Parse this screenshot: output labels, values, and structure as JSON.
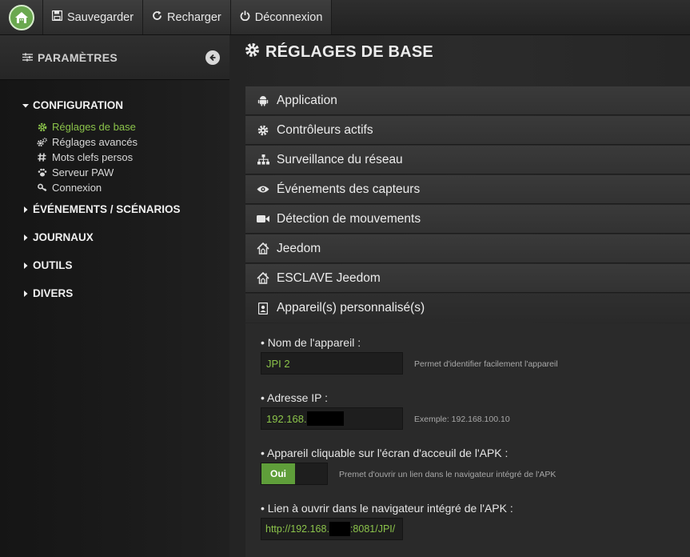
{
  "topbar": {
    "home_icon": "house-icon",
    "buttons": [
      {
        "icon": "floppy-disk-icon",
        "label": "Sauvegarder"
      },
      {
        "icon": "refresh-icon",
        "label": "Recharger"
      },
      {
        "icon": "power-icon",
        "label": "Déconnexion"
      }
    ]
  },
  "sidebar": {
    "title": "PARAMÈTRES",
    "configuration": {
      "label": "CONFIGURATION",
      "items": [
        {
          "label": "Réglages de base",
          "icon": "gear-icon",
          "active": true
        },
        {
          "label": "Réglages avancés",
          "icon": "gears-icon"
        },
        {
          "label": "Mots clefs persos",
          "icon": "hashtag-icon"
        },
        {
          "label": "Serveur PAW",
          "icon": "paw-icon"
        },
        {
          "label": "Connexion",
          "icon": "key-icon"
        }
      ]
    },
    "sections": [
      {
        "label": "ÉVÉNEMENTS / SCÉNARIOS"
      },
      {
        "label": "JOURNAUX"
      },
      {
        "label": "OUTILS"
      },
      {
        "label": "DIVERS"
      }
    ]
  },
  "main": {
    "title": "RÉGLAGES DE BASE",
    "panels": [
      {
        "label": "Application",
        "icon": "android-icon"
      },
      {
        "label": "Contrôleurs actifs",
        "icon": "gear-icon"
      },
      {
        "label": "Surveillance du réseau",
        "icon": "sitemap-icon"
      },
      {
        "label": "Événements des capteurs",
        "icon": "eye-icon"
      },
      {
        "label": "Détection de mouvements",
        "icon": "video-camera-icon"
      },
      {
        "label": "Jeedom",
        "icon": "jeedom-icon"
      },
      {
        "label": "ESCLAVE Jeedom",
        "icon": "jeedom-icon"
      },
      {
        "label": "Appareil(s) personnalisé(s)",
        "icon": "portrait-icon"
      }
    ],
    "device_form": {
      "name_label": "• Nom de l'appareil :",
      "name_value": "JPI 2",
      "name_help": "Permet d'identifier facilement l'appareil",
      "ip_label": "• Adresse IP :",
      "ip_value_prefix": "192.168.",
      "ip_help": "Exemple: 192.168.100.10",
      "clickable_label": "• Appareil cliquable sur l'écran d'acceuil de l'APK :",
      "clickable_value": "Oui",
      "clickable_help": "Premet d'ouvrir un lien dans le navigateur intégré de l'APK",
      "link_label": "• Lien à ouvrir dans le navigateur intégré de l'APK :",
      "link_value_prefix": "http://192.168.",
      "link_value_suffix": ":8081/JPI/"
    }
  },
  "colors": {
    "accent_green": "#8bc34a",
    "toggle_green": "#5f9e3a",
    "home_green": "#6aa84f"
  }
}
